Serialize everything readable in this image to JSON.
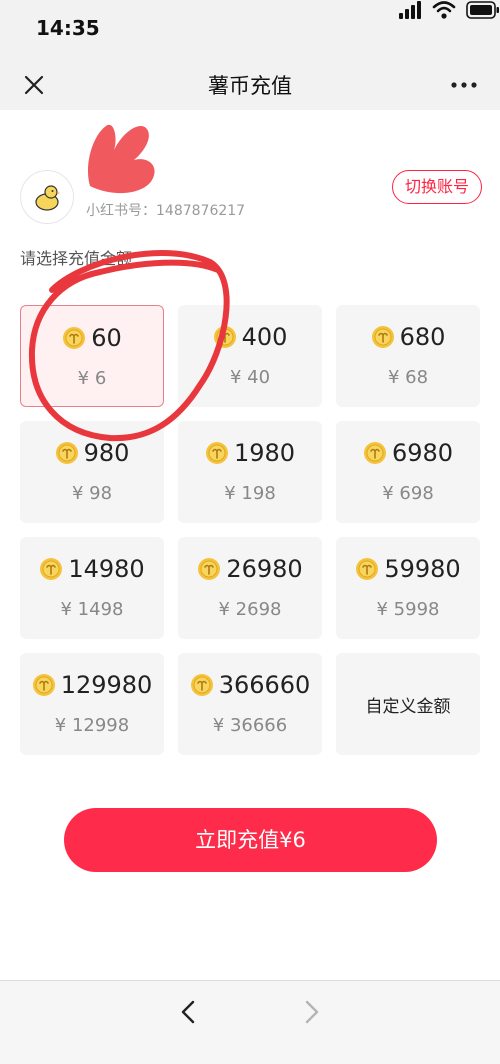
{
  "status_bar": {
    "time": "14:35"
  },
  "nav": {
    "title": "薯币充值"
  },
  "account": {
    "user_id_label": "小红书号：",
    "user_id": "1487876217",
    "switch_label": "切换账号"
  },
  "section_label": "请选择充值金额",
  "packages": [
    {
      "coins": "60",
      "price": "¥ 6",
      "selected": true
    },
    {
      "coins": "400",
      "price": "¥ 40"
    },
    {
      "coins": "680",
      "price": "¥ 68"
    },
    {
      "coins": "980",
      "price": "¥ 98"
    },
    {
      "coins": "1980",
      "price": "¥ 198"
    },
    {
      "coins": "6980",
      "price": "¥ 698"
    },
    {
      "coins": "14980",
      "price": "¥ 1498"
    },
    {
      "coins": "26980",
      "price": "¥ 2698"
    },
    {
      "coins": "59980",
      "price": "¥ 5998"
    },
    {
      "coins": "129980",
      "price": "¥ 12998"
    },
    {
      "coins": "366660",
      "price": "¥ 36666"
    }
  ],
  "custom_amount_label": "自定义金额",
  "recharge_button_label": "立即充值¥6",
  "colors": {
    "accent": "#ff2442",
    "button": "#fe2c4a",
    "coin": "#f5c33b",
    "selected_border": "#e7818e",
    "annotation": "#e8383d"
  }
}
